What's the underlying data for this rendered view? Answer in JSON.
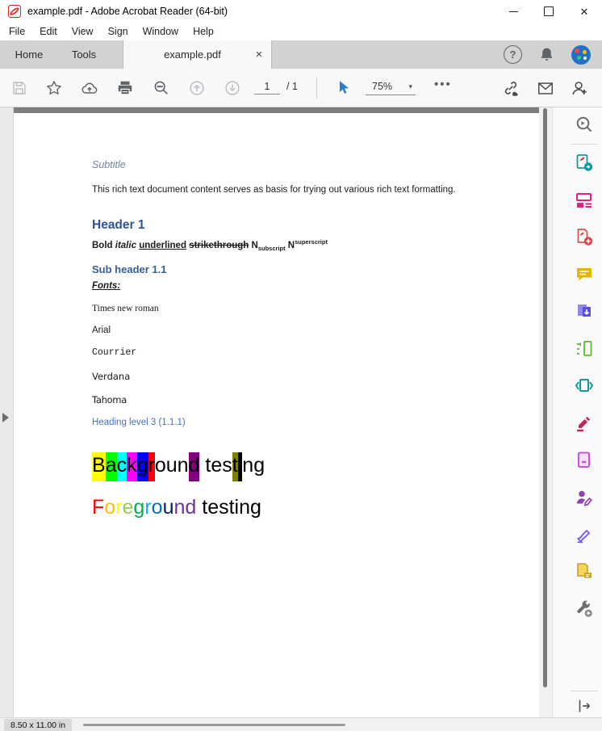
{
  "window": {
    "title": "example.pdf - Adobe Acrobat Reader (64-bit)",
    "app_icon": "acrobat-logo",
    "controls": [
      "minimize",
      "maximize",
      "close"
    ]
  },
  "menu": {
    "items": [
      "File",
      "Edit",
      "View",
      "Sign",
      "Window",
      "Help"
    ]
  },
  "tabbar": {
    "home": "Home",
    "tools": "Tools",
    "document_tab": "example.pdf",
    "close_glyph": "✕",
    "right_icons": [
      "help",
      "notifications-bell",
      "profile-avatar"
    ]
  },
  "toolbar": {
    "page_current": "1",
    "page_total": "/ 1",
    "zoom_level": "75%",
    "caret_glyph": "▾",
    "more_glyph": "•••",
    "icons": [
      "save",
      "star-favorite",
      "cloud-upload",
      "print",
      "search",
      "page-up",
      "page-down",
      "select-pointer",
      "zoom-dropdown",
      "more-options",
      "share-link",
      "email",
      "add-account"
    ]
  },
  "sidebar": {
    "tool_icons": [
      "search-tools",
      "export-pdf",
      "edit-pdf",
      "create-pdf",
      "comment",
      "combine-files",
      "organize-pages",
      "compress-pdf",
      "redact",
      "protect-pdf",
      "request-signatures",
      "fill-and-sign",
      "send-for-comments",
      "more-tools"
    ],
    "bottom_icon": "collapse-panel"
  },
  "statusbar": {
    "page_size": "8.50 x 11.00 in"
  },
  "document": {
    "subtitle": "Subtitle",
    "intro": "This rich text document content serves as basis for trying out various rich text formatting.",
    "header1": "Header 1",
    "rich_line": {
      "bold": "Bold",
      "italic": "italic",
      "underlined": "underlined",
      "strikethrough": "strikethrough",
      "n1": "N",
      "subscript": "subscript",
      "n2": "N",
      "superscript": "superscript"
    },
    "subheader": "Sub header 1.1",
    "fonts_label": "Fonts:",
    "font_samples": [
      "Times new roman",
      "Arial",
      "Courrier",
      "Verdana",
      "Tahoma"
    ],
    "heading3": "Heading level 3 (1.1.1)",
    "background_testing": [
      {
        "ch": "B",
        "bg": "#FFFF00"
      },
      {
        "ch": "a",
        "bg": "#00FF00"
      },
      {
        "ch": "c",
        "bg": "#00FFFF"
      },
      {
        "ch": "k",
        "bg": "#FF00FF"
      },
      {
        "ch": "g",
        "bg": "#0000FF"
      },
      {
        "ch": "r",
        "bg": "#FF0000"
      },
      {
        "ch": "o"
      },
      {
        "ch": "u"
      },
      {
        "ch": "n"
      },
      {
        "ch": "d",
        "bg": "#800080"
      },
      {
        "ch": " "
      },
      {
        "ch": "t"
      },
      {
        "ch": "e"
      },
      {
        "ch": "s"
      },
      {
        "ch": "t",
        "bg": "#808000"
      },
      {
        "ch": "i",
        "bg": "#000000"
      },
      {
        "ch": "n"
      },
      {
        "ch": "g"
      }
    ],
    "foreground_testing": [
      {
        "ch": "F",
        "color": "#FF0000"
      },
      {
        "ch": "o",
        "color": "#FFC000"
      },
      {
        "ch": "r",
        "color": "#FFFF00"
      },
      {
        "ch": "e",
        "color": "#92D050"
      },
      {
        "ch": "g",
        "color": "#00B050"
      },
      {
        "ch": "r",
        "color": "#00B0F0"
      },
      {
        "ch": "o",
        "color": "#0070C0"
      },
      {
        "ch": "u",
        "color": "#002060"
      },
      {
        "ch": "n",
        "color": "#7030A0"
      },
      {
        "ch": "d",
        "color": "#7030A0"
      },
      {
        "ch": " "
      },
      {
        "ch": "t"
      },
      {
        "ch": "e"
      },
      {
        "ch": "s"
      },
      {
        "ch": "t"
      },
      {
        "ch": "i"
      },
      {
        "ch": "n"
      },
      {
        "ch": "g"
      }
    ]
  },
  "colors": {
    "header_blue": "#2F5496",
    "subheader_blue": "#365F91",
    "heading3_blue": "#4472C4",
    "subtitle_blue": "#6F81A5",
    "pointer_blue": "#2B7CD3",
    "tabbar_gray": "#D2D2D2"
  }
}
